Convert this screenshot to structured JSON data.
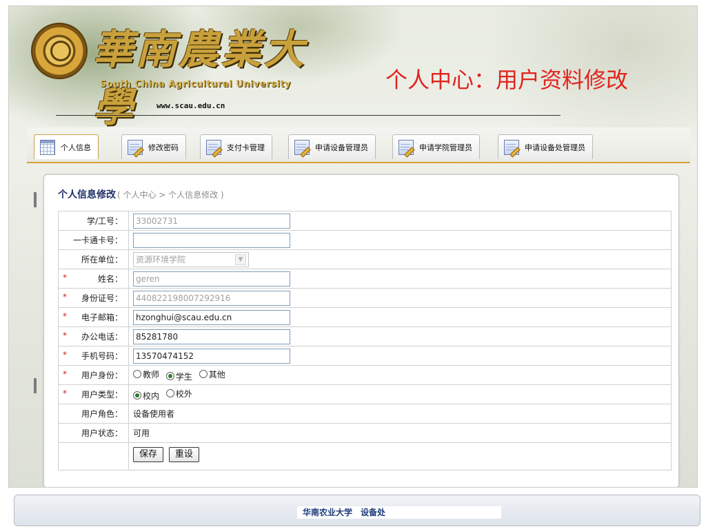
{
  "header": {
    "cn_name": "華南農業大學",
    "en_name": "South China Agricultural University",
    "url": "www.scau.edu.cn",
    "page_title": "个人中心：用户资料修改"
  },
  "tabs": [
    {
      "label": "个人信息",
      "icon": "table-icon",
      "active": true
    },
    {
      "label": "修改密码",
      "icon": "notepad-icon"
    },
    {
      "label": "支付卡管理",
      "icon": "notepad-icon"
    },
    {
      "label": "申请设备管理员",
      "icon": "notepad-icon"
    },
    {
      "label": "申请学院管理员",
      "icon": "notepad-icon"
    },
    {
      "label": "申请设备处管理员",
      "icon": "notepad-icon"
    }
  ],
  "panel": {
    "heading": "个人信息修改",
    "breadcrumb": "( 个人中心 > 个人信息修改 )"
  },
  "form": {
    "student_id": {
      "label": "学/工号：",
      "value": "33002731"
    },
    "card_no": {
      "label": "一卡通卡号：",
      "value": ""
    },
    "unit": {
      "label": "所在单位：",
      "value": "资源环境学院"
    },
    "name": {
      "label": "姓名：",
      "value": "geren",
      "required": "*"
    },
    "id_card": {
      "label": "身份证号：",
      "value": "440822198007292916",
      "required": "*"
    },
    "email": {
      "label": "电子邮箱：",
      "value": "hzonghui@scau.edu.cn",
      "required": "*"
    },
    "office_phone": {
      "label": "办公电话：",
      "value": "85281780",
      "required": "*"
    },
    "mobile": {
      "label": "手机号码：",
      "value": "13570474152",
      "required": "*"
    },
    "identity": {
      "label": "用户身份：",
      "required": "*",
      "options": [
        "教师",
        "学生",
        "其他"
      ],
      "selected": "学生"
    },
    "user_type": {
      "label": "用户类型：",
      "required": "*",
      "options": [
        "校内",
        "校外"
      ],
      "selected": "校内"
    },
    "role": {
      "label": "用户角色：",
      "value": "设备使用者"
    },
    "status": {
      "label": "用户状态：",
      "value": "可用"
    },
    "buttons": {
      "save": "保存",
      "reset": "重设"
    }
  },
  "footer": {
    "text": "华南农业大学　设备处"
  },
  "colors": {
    "title_red": "#e0241e",
    "heading_navy": "#1e2f67",
    "tab_accent": "#d3a13c"
  }
}
